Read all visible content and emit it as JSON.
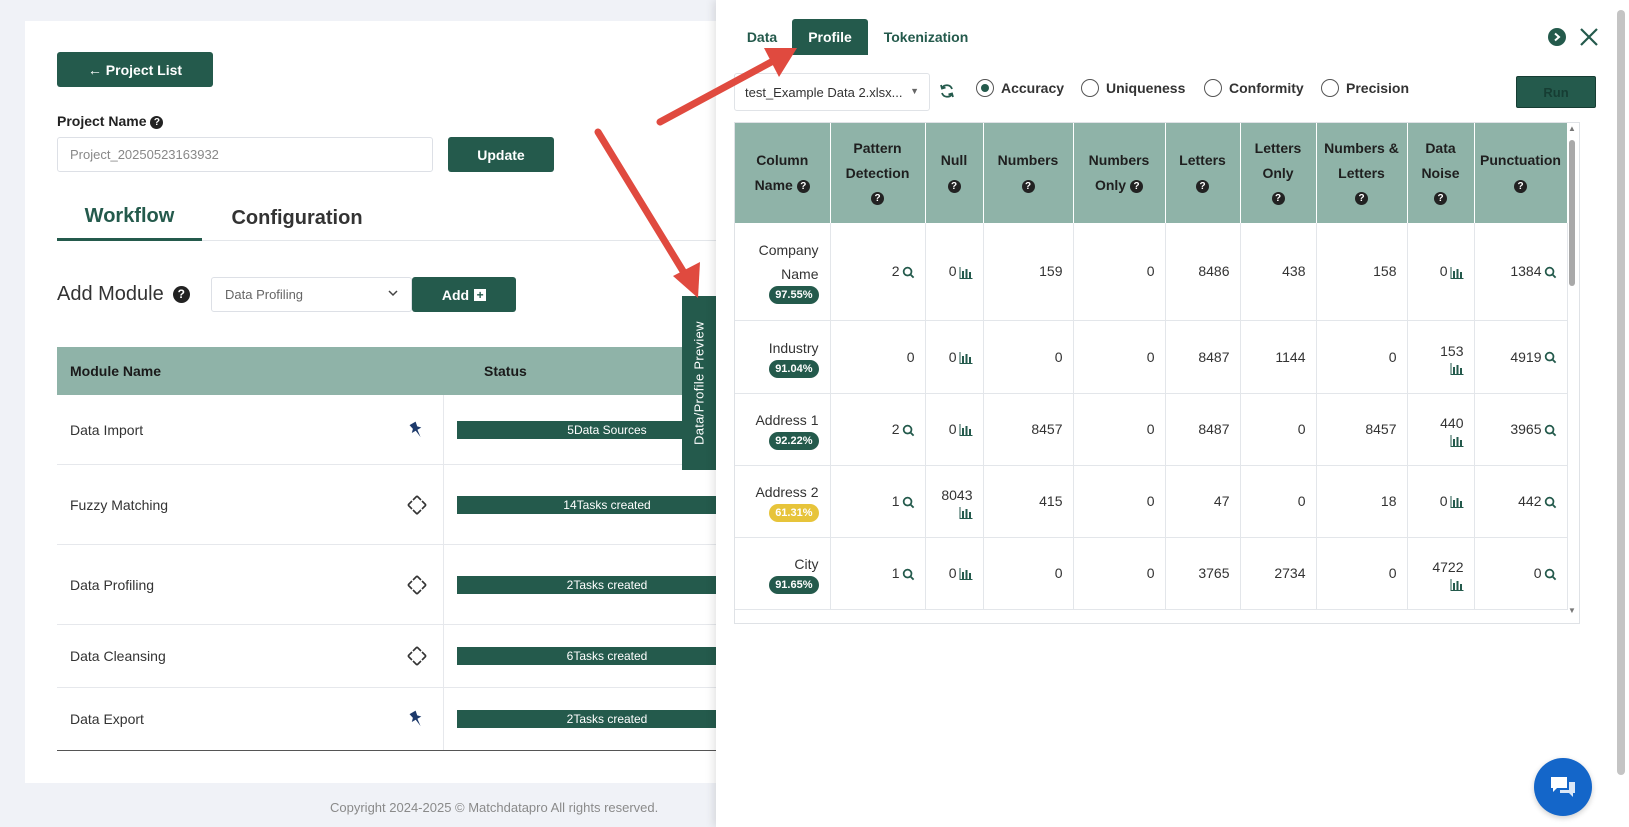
{
  "left": {
    "back_button": "← Project List",
    "project_name_label": "Project Name",
    "project_name_value": "Project_20250523163932",
    "update_button": "Update",
    "tabs": [
      "Workflow",
      "Configuration"
    ],
    "add_module_label": "Add Module",
    "module_select_value": "Data Profiling",
    "add_button": "Add",
    "table_headers": [
      "Module Name",
      "Status"
    ],
    "modules": [
      {
        "name": "Data Import",
        "icon": "pin-icon",
        "status": "5Data Sources"
      },
      {
        "name": "Fuzzy Matching",
        "icon": "move-icon",
        "status": "14Tasks created"
      },
      {
        "name": "Data Profiling",
        "icon": "move-icon",
        "status": "2Tasks created"
      },
      {
        "name": "Data Cleansing",
        "icon": "move-icon",
        "status": "6Tasks created"
      },
      {
        "name": "Data Export",
        "icon": "pin-icon",
        "status": "2Tasks created"
      }
    ],
    "copyright": "Copyright 2024-2025 © Matchdatapro All rights reserved."
  },
  "preview_tab": "Data/Profile Preview",
  "panel": {
    "tabs": [
      "Data",
      "Profile",
      "Tokenization"
    ],
    "active_tab": "Profile",
    "file_select": "test_Example Data 2.xlsx...",
    "radios": [
      {
        "label": "Accuracy",
        "checked": true
      },
      {
        "label": "Uniqueness",
        "checked": false
      },
      {
        "label": "Conformity",
        "checked": false
      },
      {
        "label": "Precision",
        "checked": false
      }
    ],
    "run_button": "Run",
    "columns": [
      "Column Name",
      "Pattern Detection",
      "Null",
      "Numbers",
      "Numbers Only",
      "Letters",
      "Letters Only",
      "Numbers & Letters",
      "Data Noise",
      "Punctuation"
    ],
    "rows": [
      {
        "name": "Company Name",
        "pct": "97.55%",
        "warn": false,
        "pattern": "2",
        "null": "0",
        "numbers": "159",
        "numbers_only": "0",
        "letters": "8486",
        "letters_only": "438",
        "num_letters": "158",
        "noise": "0",
        "punct": "1384"
      },
      {
        "name": "Industry",
        "pct": "91.04%",
        "warn": false,
        "pattern": "0",
        "null": "0",
        "numbers": "0",
        "numbers_only": "0",
        "letters": "8487",
        "letters_only": "1144",
        "num_letters": "0",
        "noise": "153",
        "punct": "4919"
      },
      {
        "name": "Address 1",
        "pct": "92.22%",
        "warn": false,
        "pattern": "2",
        "null": "0",
        "numbers": "8457",
        "numbers_only": "0",
        "letters": "8487",
        "letters_only": "0",
        "num_letters": "8457",
        "noise": "440",
        "punct": "3965"
      },
      {
        "name": "Address 2",
        "pct": "61.31%",
        "warn": true,
        "pattern": "1",
        "null": "8043",
        "numbers": "415",
        "numbers_only": "0",
        "letters": "47",
        "letters_only": "0",
        "num_letters": "18",
        "noise": "0",
        "punct": "442"
      },
      {
        "name": "City",
        "pct": "91.65%",
        "warn": false,
        "pattern": "1",
        "null": "0",
        "numbers": "0",
        "numbers_only": "0",
        "letters": "3765",
        "letters_only": "2734",
        "num_letters": "0",
        "noise": "4722",
        "punct": "0"
      }
    ]
  },
  "colors": {
    "accent": "#245a4c",
    "header": "#8fb3a8",
    "warn": "#e7c43a",
    "arrow": "#e04a3f",
    "chat": "#1466c9"
  }
}
